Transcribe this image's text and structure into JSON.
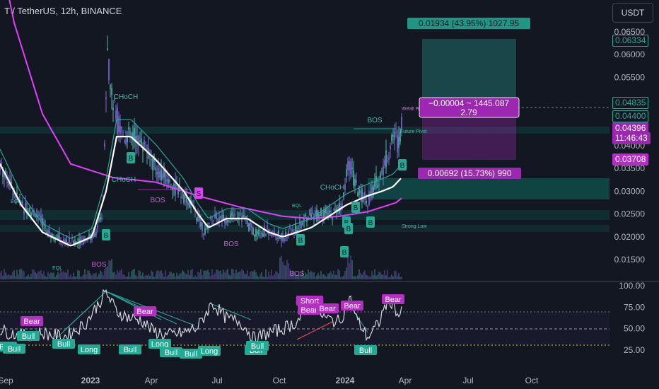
{
  "header": {
    "title": "T / TetherUS, 12h, BINANCE"
  },
  "currency": "USDT",
  "colors": {
    "bg": "#131722",
    "bull": "#089981",
    "bull_label": "#22ab94",
    "bear": "#9c27b0",
    "ma_fast": "#ffffff",
    "ma_slow": "#e040fb",
    "teal_line": "#26a69a"
  },
  "chart_data": [
    {
      "type": "candlestick",
      "ylim": [
        0.01,
        0.068
      ],
      "yticks": [
        "0.06500",
        "0.06000",
        "0.05500",
        "0.05000",
        "0.04500",
        "0.04000",
        "0.03500",
        "0.03000",
        "0.02500",
        "0.02000",
        "0.01500"
      ],
      "x_ticks": [
        "Sep",
        "2023",
        "Apr",
        "Jul",
        "Oct",
        "2024",
        "Apr",
        "Jul",
        "Oct"
      ],
      "price_tags": [
        {
          "value": "0.06334",
          "color": "#22ab94"
        },
        {
          "value": "0.04835",
          "color": "#22ab94"
        },
        {
          "value": "0.04400",
          "color": "#22ab94"
        },
        {
          "value": "0.04396",
          "color": "#9c27b0"
        },
        {
          "value": "11:46:43",
          "color": "#9c27b0"
        },
        {
          "value": "0.03708",
          "color": "#b62dc6"
        }
      ],
      "position_labels": {
        "target": "0.01934 (43.95%) 1027.95",
        "mid_line1": "−0.00004 ~ 1445.087",
        "mid_line2": "2.79",
        "stop": "0.00692 (15.73%) 990"
      },
      "structure_labels": [
        "BOS",
        "CHoCH",
        "CHoCH",
        "CHoCH",
        "BOS",
        "BOS",
        "BOS",
        "BOS",
        "EQL",
        "EQL",
        "EQL",
        "Weak High",
        "Strong Low",
        "Future Pivot"
      ],
      "signals": [
        {
          "t": "B",
          "side": "bull"
        },
        {
          "t": "B",
          "side": "bull"
        },
        {
          "t": "B",
          "side": "bull"
        },
        {
          "t": "B",
          "side": "bull"
        },
        {
          "t": "B",
          "side": "bull"
        },
        {
          "t": "B",
          "side": "bull"
        },
        {
          "t": "B",
          "side": "bull"
        },
        {
          "t": "B",
          "side": "bull"
        },
        {
          "t": "B",
          "side": "bull"
        },
        {
          "t": "S",
          "side": "bear"
        }
      ],
      "anchors": {
        "ma_slow": [
          [
            0,
            0.082
          ],
          [
            20,
            0.067
          ],
          [
            60,
            0.047
          ],
          [
            100,
            0.036
          ],
          [
            160,
            0.033
          ],
          [
            220,
            0.032
          ],
          [
            280,
            0.029
          ],
          [
            340,
            0.0265
          ],
          [
            400,
            0.0245
          ],
          [
            440,
            0.024
          ],
          [
            480,
            0.0245
          ],
          [
            520,
            0.0255
          ],
          [
            560,
            0.0275
          ],
          [
            568,
            0.0285
          ]
        ],
        "ma_fast": [
          [
            0,
            0.036
          ],
          [
            30,
            0.027
          ],
          [
            60,
            0.021
          ],
          [
            100,
            0.018
          ],
          [
            130,
            0.02
          ],
          [
            150,
            0.03
          ],
          [
            165,
            0.042
          ],
          [
            185,
            0.042
          ],
          [
            220,
            0.037
          ],
          [
            260,
            0.03
          ],
          [
            280,
            0.025
          ],
          [
            295,
            0.022
          ],
          [
            320,
            0.024
          ],
          [
            350,
            0.024
          ],
          [
            380,
            0.021
          ],
          [
            400,
            0.02
          ],
          [
            440,
            0.022
          ],
          [
            470,
            0.025
          ],
          [
            490,
            0.027
          ],
          [
            520,
            0.029
          ],
          [
            540,
            0.03
          ],
          [
            556,
            0.031
          ],
          [
            568,
            0.033
          ]
        ],
        "price": [
          [
            0,
            0.036
          ],
          [
            10,
            0.033
          ],
          [
            30,
            0.027
          ],
          [
            50,
            0.025
          ],
          [
            70,
            0.021
          ],
          [
            90,
            0.019
          ],
          [
            110,
            0.019
          ],
          [
            130,
            0.02
          ],
          [
            145,
            0.024
          ],
          [
            152,
            0.06
          ],
          [
            158,
            0.05
          ],
          [
            165,
            0.046
          ],
          [
            175,
            0.042
          ],
          [
            190,
            0.042
          ],
          [
            205,
            0.04
          ],
          [
            220,
            0.035
          ],
          [
            240,
            0.032
          ],
          [
            260,
            0.029
          ],
          [
            275,
            0.026
          ],
          [
            290,
            0.021
          ],
          [
            300,
            0.024
          ],
          [
            320,
            0.024
          ],
          [
            340,
            0.025
          ],
          [
            360,
            0.021
          ],
          [
            380,
            0.021
          ],
          [
            400,
            0.02
          ],
          [
            420,
            0.022
          ],
          [
            440,
            0.025
          ],
          [
            470,
            0.025
          ],
          [
            485,
            0.027
          ],
          [
            493,
            0.037
          ],
          [
            505,
            0.03
          ],
          [
            520,
            0.028
          ],
          [
            540,
            0.034
          ],
          [
            556,
            0.042
          ],
          [
            562,
            0.041
          ],
          [
            568,
            0.044
          ]
        ]
      }
    },
    {
      "type": "line",
      "name": "RSI",
      "ylim": [
        20,
        100
      ],
      "yticks": [
        "100.00",
        "75.00",
        "50.00",
        "25.00"
      ],
      "levels": [
        70,
        50,
        30
      ],
      "labels": [
        {
          "t": "Bear",
          "side": "bear"
        },
        {
          "t": "Bear",
          "side": "bear"
        },
        {
          "t": "Short",
          "side": "bear"
        },
        {
          "t": "Bear",
          "side": "bear"
        },
        {
          "t": "Bear",
          "side": "bear"
        },
        {
          "t": "Bear",
          "side": "bear"
        },
        {
          "t": "Bear",
          "side": "bear"
        },
        {
          "t": "Bull",
          "side": "bull"
        },
        {
          "t": "Bull",
          "side": "bull"
        },
        {
          "t": "Bull",
          "side": "bull"
        },
        {
          "t": "Bull",
          "side": "bull"
        },
        {
          "t": "Long",
          "side": "bull"
        },
        {
          "t": "Bull",
          "side": "bull"
        },
        {
          "t": "Long",
          "side": "bull"
        },
        {
          "t": "Bull",
          "side": "bull"
        },
        {
          "t": "Bull",
          "side": "bull"
        },
        {
          "t": "Long",
          "side": "bull"
        },
        {
          "t": "Bull",
          "side": "bull"
        },
        {
          "t": "Bull",
          "side": "bull"
        },
        {
          "t": "Bull",
          "side": "bull"
        }
      ],
      "anchors": [
        [
          0,
          48
        ],
        [
          30,
          42
        ],
        [
          60,
          45
        ],
        [
          90,
          40
        ],
        [
          120,
          55
        ],
        [
          140,
          80
        ],
        [
          150,
          92
        ],
        [
          165,
          70
        ],
        [
          185,
          62
        ],
        [
          200,
          60
        ],
        [
          215,
          48
        ],
        [
          235,
          42
        ],
        [
          260,
          45
        ],
        [
          280,
          52
        ],
        [
          300,
          80
        ],
        [
          320,
          62
        ],
        [
          340,
          58
        ],
        [
          360,
          38
        ],
        [
          380,
          45
        ],
        [
          400,
          50
        ],
        [
          420,
          58
        ],
        [
          440,
          80
        ],
        [
          460,
          62
        ],
        [
          480,
          58
        ],
        [
          495,
          85
        ],
        [
          505,
          60
        ],
        [
          520,
          40
        ],
        [
          535,
          55
        ],
        [
          545,
          78
        ],
        [
          556,
          82
        ],
        [
          563,
          65
        ],
        [
          568,
          68
        ]
      ]
    }
  ]
}
